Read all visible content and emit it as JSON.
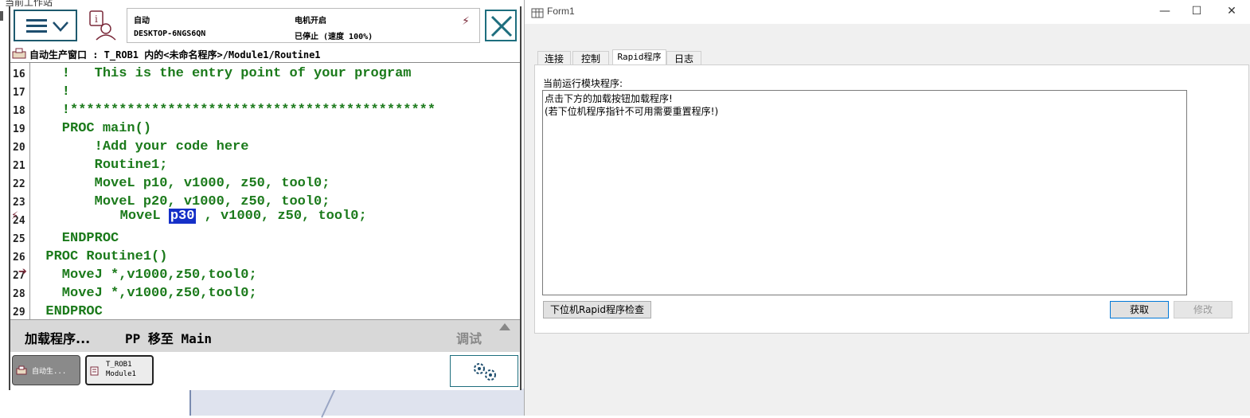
{
  "desktop": {
    "title": "当前工作站"
  },
  "flexpendant": {
    "status": {
      "mode": "自动",
      "motors": "电机开启",
      "host": "DESKTOP-6NGS6QN",
      "state": "已停止 (速度 100%)"
    },
    "breadcrumb": "自动生产窗口 : T_ROB1 内的<未命名程序>/Module1/Routine1",
    "code": {
      "lines": [
        {
          "no": "16",
          "text": "    !   This is the entry point of your program"
        },
        {
          "no": "17",
          "text": "    !"
        },
        {
          "no": "18",
          "text": "    !*********************************************"
        },
        {
          "no": "19",
          "text": "    PROC main()"
        },
        {
          "no": "20",
          "text": "        !Add your code here"
        },
        {
          "no": "21",
          "text": "        Routine1;"
        },
        {
          "no": "22",
          "text": "        MoveL p10, v1000, z50, tool0;"
        },
        {
          "no": "23",
          "text": "        MoveL p20, v1000, z50, tool0;"
        },
        {
          "no": "24",
          "text": ""
        },
        {
          "no": "25",
          "text": "    ENDPROC"
        },
        {
          "no": "26",
          "text": "  PROC Routine1()"
        },
        {
          "no": "27",
          "text": "    MoveJ *,v1000,z50,tool0;"
        },
        {
          "no": "28",
          "text": "    MoveJ *,v1000,z50,tool0;"
        },
        {
          "no": "29",
          "text": "  ENDPROC"
        }
      ],
      "line24_prefix": "        MoveL ",
      "line24_highlight": "p30",
      "line24_suffix": " , v1000, z50, tool0;"
    },
    "commands": {
      "load": "加载程序...",
      "pp_main": "PP 移至 Main",
      "debug": "调试"
    },
    "taskbar": {
      "task1": "自动生...",
      "task2_line1": "T_ROB1",
      "task2_line2": "Module1"
    }
  },
  "form": {
    "title": "Form1",
    "tabs": [
      "连接",
      "控制",
      "Rapid程序",
      "日志"
    ],
    "active_tab": "Rapid程序",
    "label": "当前运行模块程序:",
    "text_line1": "点击下方的加载按钮加载程序!",
    "text_line2": "(若下位机程序指针不可用需要重置程序!)",
    "check_button": "下位机Rapid程序检查",
    "fetch_button": "获取",
    "edit_button": "修改"
  }
}
